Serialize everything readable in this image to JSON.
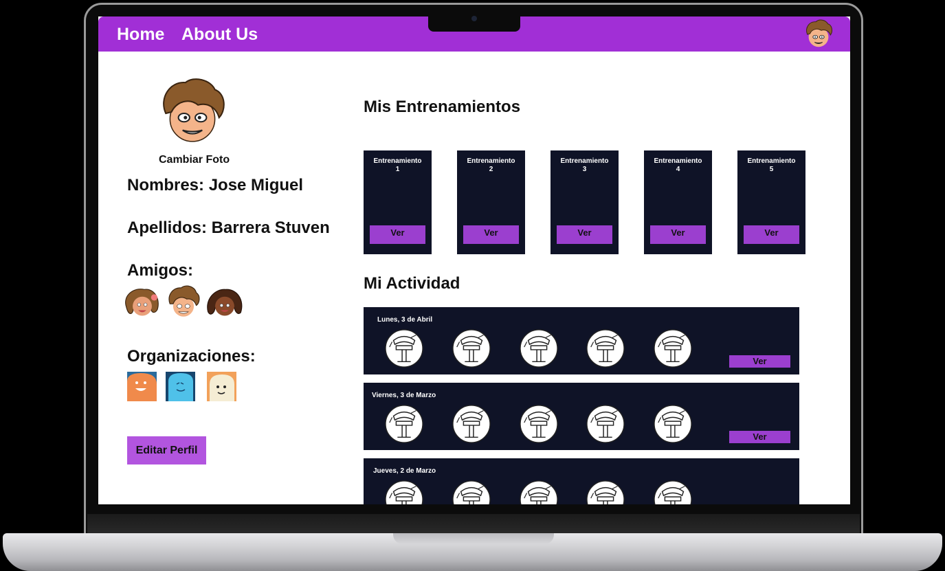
{
  "nav": {
    "home_label": "Home",
    "about_label": "About Us",
    "avatar_icon": "user-avatar-icon"
  },
  "profile": {
    "change_photo_label": "Cambiar Foto",
    "names_line": "Nombres: Jose Miguel",
    "surnames_line": "Apellidos: Barrera Stuven",
    "friends_heading": "Amigos:",
    "friends": [
      "friend-girl-icon",
      "friend-boy-icon",
      "friend-girl-dark-icon"
    ],
    "orgs_heading": "Organizaciones:",
    "orgs": [
      {
        "icon": "org-orange-icon",
        "color": "#f08a4b"
      },
      {
        "icon": "org-blue-icon",
        "color": "#4fc1e9"
      },
      {
        "icon": "org-cream-icon",
        "color": "#f2a15a"
      }
    ],
    "edit_button_label": "Editar Perfil"
  },
  "workouts": {
    "heading": "Mis Entrenamientos",
    "items": [
      {
        "title": "Entrenamiento",
        "number": "1",
        "button": "Ver"
      },
      {
        "title": "Entrenamiento",
        "number": "2",
        "button": "Ver"
      },
      {
        "title": "Entrenamiento",
        "number": "3",
        "button": "Ver"
      },
      {
        "title": "Entrenamiento",
        "number": "4",
        "button": "Ver"
      },
      {
        "title": "Entrenamiento",
        "number": "5",
        "button": "Ver"
      }
    ]
  },
  "activity": {
    "heading": "Mi Actividad",
    "entries": [
      {
        "date": "Lunes, 3 de Abril",
        "button": "Ver"
      },
      {
        "date": "Viernes, 3 de Marzo",
        "button": "Ver"
      },
      {
        "date": "Jueves, 2 de Marzo",
        "button": ""
      }
    ],
    "exercise_icon": "exercise-machine-icon"
  },
  "colors": {
    "accent": "#a12fd6",
    "button": "#9b3fcf",
    "card_bg": "#0f1327"
  }
}
